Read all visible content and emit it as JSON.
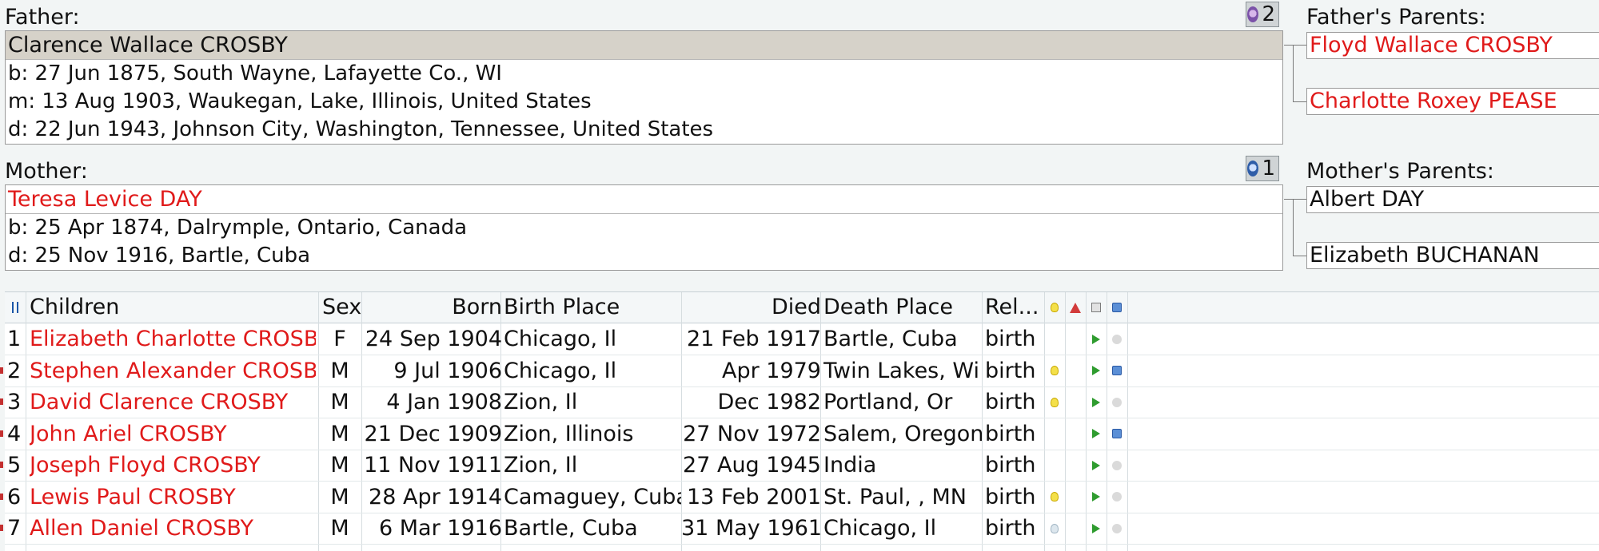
{
  "father": {
    "caption": "Father:",
    "name": "Clarence Wallace CROSBY",
    "facts": [
      "b: 27 Jun 1875, South Wayne, Lafayette Co., WI",
      "m: 13 Aug 1903, Waukegan, Lake, Illinois, United States",
      "d: 22 Jun 1943, Johnson City, Washington, Tennessee, United States"
    ],
    "spouse_count": "2"
  },
  "mother": {
    "caption": "Mother:",
    "name": "Teresa Levice DAY",
    "facts": [
      "b: 25 Apr 1874, Dalrymple, Ontario, Canada",
      "d: 25 Nov 1916, Bartle, Cuba"
    ],
    "spouse_count": "1"
  },
  "fathers_parents": {
    "caption": "Father's Parents:",
    "father": "Floyd Wallace CROSBY",
    "mother": "Charlotte Roxey PEASE"
  },
  "mothers_parents": {
    "caption": "Mother's Parents:",
    "father": "Albert DAY",
    "mother": "Elizabeth BUCHANAN"
  },
  "children_table": {
    "columns": {
      "children": "Children",
      "sex": "Sex",
      "born": "Born",
      "birth_place": "Birth Place",
      "died": "Died",
      "death_place": "Death Place",
      "relationship": "Rel..."
    },
    "rows": [
      {
        "num": "1",
        "name": "Elizabeth Charlotte CROSBY",
        "sex": "F",
        "born": "24 Sep 1904",
        "birth_place": "Chicago, Il",
        "died": "21 Feb 1917",
        "death_place": "Bartle, Cuba",
        "rel": "birth",
        "note": "none",
        "map": "off"
      },
      {
        "num": "2",
        "name": "Stephen Alexander CROSBY",
        "sex": "M",
        "born": "9 Jul 1906",
        "birth_place": "Chicago, Il",
        "died": "Apr 1979",
        "death_place": "Twin Lakes, Wi",
        "rel": "birth",
        "note": "on",
        "map": "on"
      },
      {
        "num": "3",
        "name": "David Clarence CROSBY",
        "sex": "M",
        "born": "4 Jan 1908",
        "birth_place": "Zion, Il",
        "died": "Dec 1982",
        "death_place": "Portland, Or",
        "rel": "birth",
        "note": "on",
        "map": "off"
      },
      {
        "num": "4",
        "name": "John Ariel CROSBY",
        "sex": "M",
        "born": "21 Dec 1909",
        "birth_place": "Zion, Illinois",
        "died": "27 Nov 1972",
        "death_place": "Salem, Oregon",
        "rel": "birth",
        "note": "none",
        "map": "on"
      },
      {
        "num": "5",
        "name": "Joseph Floyd CROSBY",
        "sex": "M",
        "born": "11 Nov 1911",
        "birth_place": "Zion, Il",
        "died": "27 Aug 1945",
        "death_place": "India",
        "rel": "birth",
        "note": "none",
        "map": "off"
      },
      {
        "num": "6",
        "name": "Lewis Paul CROSBY",
        "sex": "M",
        "born": "28 Apr 1914",
        "birth_place": "Camaguey, Cuba",
        "died": "13 Feb 2001",
        "death_place": "St. Paul, , MN",
        "rel": "birth",
        "note": "on",
        "map": "off"
      },
      {
        "num": "7",
        "name": "Allen Daniel CROSBY",
        "sex": "M",
        "born": "6 Mar 1916",
        "birth_place": "Bartle, Cuba",
        "died": "31 May 1961",
        "death_place": "Chicago, Il",
        "rel": "birth",
        "note": "off",
        "map": "off"
      }
    ]
  },
  "colors": {
    "name_red": "#e01a1a",
    "selected_bg": "#d6d2c9"
  }
}
